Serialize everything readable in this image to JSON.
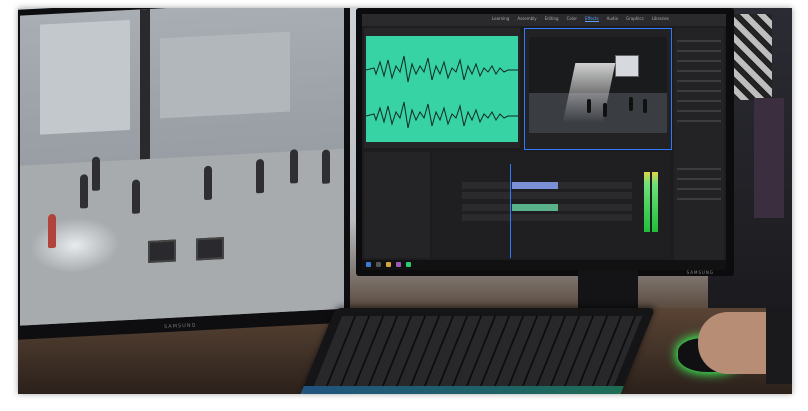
{
  "photo": {
    "left_monitor": {
      "brand": "SAMSUNG"
    },
    "right_monitor": {
      "brand": "SAMSUNG",
      "app": {
        "title_bar": "",
        "tabs": [
          {
            "label": "Learning"
          },
          {
            "label": "Assembly"
          },
          {
            "label": "Editing"
          },
          {
            "label": "Color"
          },
          {
            "label": "Effects",
            "active": true
          },
          {
            "label": "Audio"
          },
          {
            "label": "Graphics"
          },
          {
            "label": "Libraries"
          }
        ],
        "source_title": "",
        "source_timecode": "",
        "program_title": "",
        "program_timecode": "",
        "project_title": "",
        "project_items": [],
        "timeline_title": "",
        "timeline_timecode": "",
        "effects_labels": []
      }
    }
  },
  "colors": {
    "waveform_bg": "#37d3a5",
    "accent": "#2e7bff",
    "timecode": "#e6c24a",
    "mouse_glow": "#3cff5a"
  }
}
